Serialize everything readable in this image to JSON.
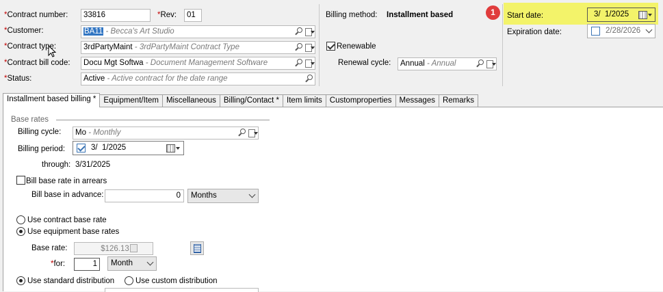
{
  "header": {
    "contract_number_label": "Contract number:",
    "contract_number": "33816",
    "rev_label": "Rev:",
    "rev": "01",
    "customer_label": "Customer:",
    "customer_code": "BA11",
    "customer_desc": "- Becca's Art Studio",
    "contract_type_label": "Contract type:",
    "contract_type_code": "3rdPartyMaint",
    "contract_type_desc": "- 3rdPartyMaint Contract Type",
    "bill_code_label": "Contract bill code:",
    "bill_code_code": "Docu Mgt Softwa",
    "bill_code_desc": "- Document Management Software",
    "status_label": "Status:",
    "status_code": "Active",
    "status_desc": "- Active contract for the date range",
    "billing_method_label": "Billing method:",
    "billing_method": "Installment based",
    "renewable_label": "Renewable",
    "renewal_cycle_label": "Renewal cycle:",
    "renewal_cycle_code": "Annual",
    "renewal_cycle_desc": "- Annual",
    "start_date_label": "Start date:",
    "start_date": "3/  1/2025",
    "expiration_date_label": "Expiration date:",
    "expiration_date": "2/28/2026",
    "callout_number": "1"
  },
  "tabs": [
    {
      "label": "Installment based billing *"
    },
    {
      "label": "Equipment/Item"
    },
    {
      "label": "Miscellaneous"
    },
    {
      "label": "Billing/Contact *"
    },
    {
      "label": "Item limits"
    },
    {
      "label": "Customproperties"
    },
    {
      "label": "Messages"
    },
    {
      "label": "Remarks"
    }
  ],
  "billing": {
    "section_title": "Base rates",
    "billing_cycle_label": "Billing cycle:",
    "billing_cycle_code": "Mo",
    "billing_cycle_desc": "- Monthly",
    "billing_period_label": "Billing period:",
    "billing_period": "3/  1/2025",
    "through_label": "through:",
    "through": "3/31/2025",
    "arrears_label": "Bill base rate in arrears",
    "advance_label": "Bill base in advance:",
    "advance_value": "0",
    "advance_unit": "Months",
    "use_contract_rate_label": "Use contract base rate",
    "use_equipment_rates_label": "Use equipment base rates",
    "base_rate_label": "Base rate:",
    "base_rate": "$126.13",
    "for_label": "for:",
    "for_value": "1",
    "for_unit": "Month",
    "standard_dist_label": "Use standard distribution",
    "custom_dist_label": "Use custom distribution"
  }
}
